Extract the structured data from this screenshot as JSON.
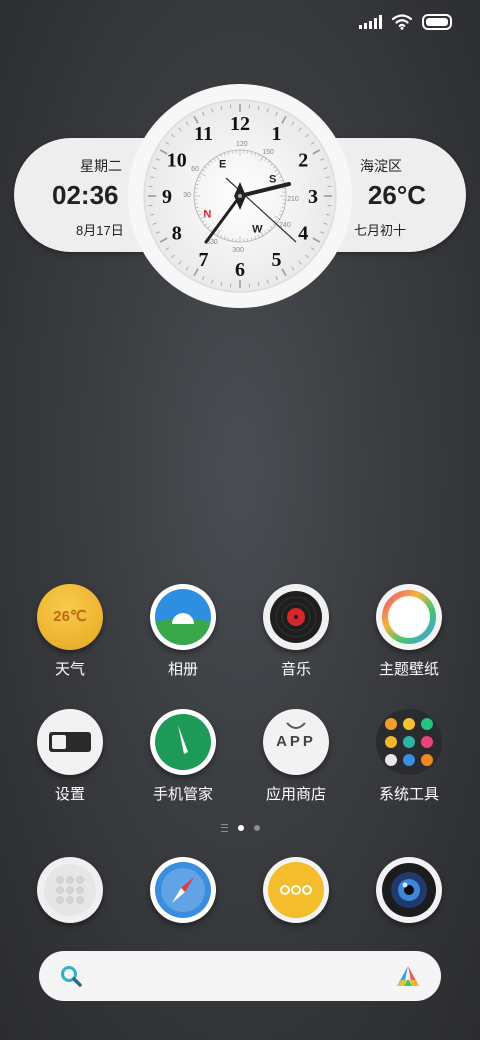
{
  "widget": {
    "day_of_week": "星期二",
    "time": "02:36",
    "date": "8月17日",
    "district": "海淀区",
    "temperature": "26°C",
    "lunar_date": "七月初十",
    "clock_numbers": [
      "12",
      "1",
      "2",
      "3",
      "4",
      "5",
      "6",
      "7",
      "8",
      "9",
      "10",
      "11"
    ],
    "compass_letters": [
      "N",
      "E",
      "S",
      "W"
    ],
    "compass_degrees": [
      "30",
      "60",
      "120",
      "150",
      "210",
      "240",
      "300",
      "330"
    ]
  },
  "apps": [
    {
      "label": "天气",
      "icon": "weather-icon",
      "badge": "26℃"
    },
    {
      "label": "相册",
      "icon": "gallery-icon"
    },
    {
      "label": "音乐",
      "icon": "music-icon"
    },
    {
      "label": "主题壁纸",
      "icon": "themes-icon"
    },
    {
      "label": "设置",
      "icon": "settings-icon"
    },
    {
      "label": "手机管家",
      "icon": "security-icon"
    },
    {
      "label": "应用商店",
      "icon": "app-store-icon",
      "badge": "APP"
    },
    {
      "label": "系统工具",
      "icon": "system-tools-folder-icon"
    }
  ],
  "dock": [
    {
      "icon": "phone-dialer-icon"
    },
    {
      "icon": "browser-compass-icon"
    },
    {
      "icon": "messages-icon"
    },
    {
      "icon": "camera-icon"
    }
  ],
  "page_indicator": {
    "pages": 2,
    "current": 1
  },
  "colors": {
    "weather_yellow": "#f1b52c",
    "gallery_blue": "#2e8fe0",
    "gallery_green": "#39a84a",
    "security_green": "#1d9a57",
    "compass_red": "#d6262c"
  }
}
